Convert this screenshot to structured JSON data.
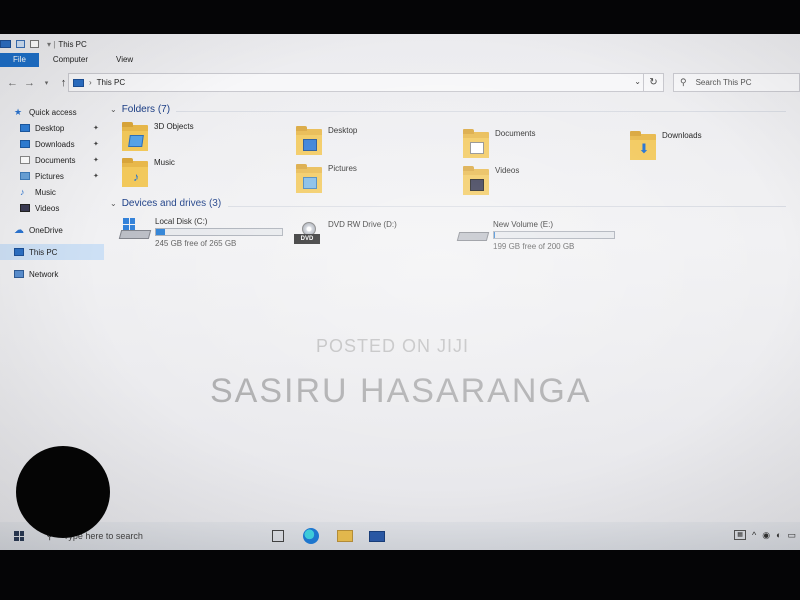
{
  "window": {
    "title": "This PC"
  },
  "ribbon": {
    "tabs": [
      "File",
      "Computer",
      "View"
    ]
  },
  "address": {
    "path": "This PC",
    "search_placeholder": "Search This PC"
  },
  "nav": {
    "quick_access": "Quick access",
    "items": [
      {
        "label": "Desktop",
        "icon": "desktop-icon",
        "pinned": true
      },
      {
        "label": "Downloads",
        "icon": "download-icon",
        "pinned": true
      },
      {
        "label": "Documents",
        "icon": "document-icon",
        "pinned": true
      },
      {
        "label": "Pictures",
        "icon": "pictures-icon",
        "pinned": true
      },
      {
        "label": "Music",
        "icon": "music-icon",
        "pinned": false
      },
      {
        "label": "Videos",
        "icon": "videos-icon",
        "pinned": false
      }
    ],
    "onedrive": "OneDrive",
    "this_pc": "This PC",
    "network": "Network"
  },
  "folders": {
    "header": "Folders (7)",
    "items": [
      {
        "label": "3D Objects",
        "icon": "3d-objects-icon"
      },
      {
        "label": "Desktop",
        "icon": "desktop-folder-icon"
      },
      {
        "label": "Documents",
        "icon": "documents-folder-icon"
      },
      {
        "label": "Downloads",
        "icon": "downloads-folder-icon"
      },
      {
        "label": "Music",
        "icon": "music-folder-icon"
      },
      {
        "label": "Pictures",
        "icon": "pictures-folder-icon"
      },
      {
        "label": "Videos",
        "icon": "videos-folder-icon"
      }
    ]
  },
  "drives": {
    "header": "Devices and drives (3)",
    "items": [
      {
        "label": "Local Disk (C:)",
        "free": "245 GB free of 265 GB",
        "used_fraction": 0.075
      },
      {
        "label": "DVD RW Drive (D:)",
        "badge": "DVD"
      },
      {
        "label": "New Volume (E:)",
        "free": "199 GB free of 200 GB",
        "used_fraction": 0.005
      }
    ]
  },
  "watermark": {
    "line1": "POSTED ON JIJI",
    "line2": "SASIRU HASARANGA"
  },
  "taskbar": {
    "search_placeholder": "Type here to search"
  },
  "colors": {
    "accent": "#1d6fc8",
    "folder": "#f2c85a",
    "bar_fill": "#2a80d6"
  }
}
